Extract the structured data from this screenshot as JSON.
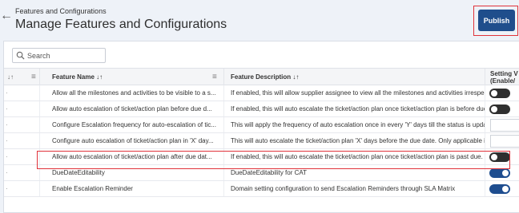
{
  "header": {
    "breadcrumb": "Features and Configurations",
    "title": "Manage Features and Configurations",
    "back_icon": "arrow-left-icon",
    "back_glyph": "←"
  },
  "toolbar": {
    "publish_label": "Publish"
  },
  "search": {
    "placeholder": "Search",
    "value": "",
    "icon": "search-icon"
  },
  "table": {
    "columns": {
      "sort_indicator": "↓↑",
      "first_menu_glyph": "≡",
      "name": "Feature Name ↓↑",
      "name_menu_glyph": "≡",
      "description": "Feature Description ↓↑",
      "setting_line1": "Setting V",
      "setting_line2": "(Enable/"
    },
    "rows": [
      {
        "name": "Allow all the milestones and activities to be visible to a s...",
        "description": "If enabled, this will allow supplier assignee to view all the milestones and activities irrespec",
        "control": "toggle",
        "enabled": false
      },
      {
        "name": "Allow auto escalation of ticket/action plan before due d...",
        "description": "If enabled, this will auto escalate the ticket/action plan once ticket/action plan is before due",
        "control": "toggle",
        "enabled": false
      },
      {
        "name": "Configure Escalation frequency for auto-escalation of tic...",
        "description": "This will apply the frequency of auto escalation once in every 'Y' days till the status is updat",
        "control": "input",
        "value": ""
      },
      {
        "name": "Configure auto escalation of ticket/action plan in 'X' day...",
        "description": "This will auto escalate the ticket/action plan 'X' days before the due date. Only applicable if",
        "control": "input",
        "value": ""
      },
      {
        "name": "Allow auto escalation of ticket/action plan after due dat...",
        "description": "If enabled, this will auto escalate the ticket/action plan once ticket/action plan is past due.",
        "control": "toggle",
        "enabled": false
      },
      {
        "name": "DueDateEditability",
        "description": "DueDateEditability for CAT",
        "control": "toggle",
        "enabled": true
      },
      {
        "name": "Enable Escalation Reminder",
        "description": "Domain setting configuration to send Escalation Reminders through SLA Matrix",
        "control": "toggle",
        "enabled": true,
        "highlighted": true
      }
    ]
  },
  "colors": {
    "accent": "#1e4d8f",
    "highlight": "#e0323a",
    "toggle_off": "#2f2f2f"
  }
}
